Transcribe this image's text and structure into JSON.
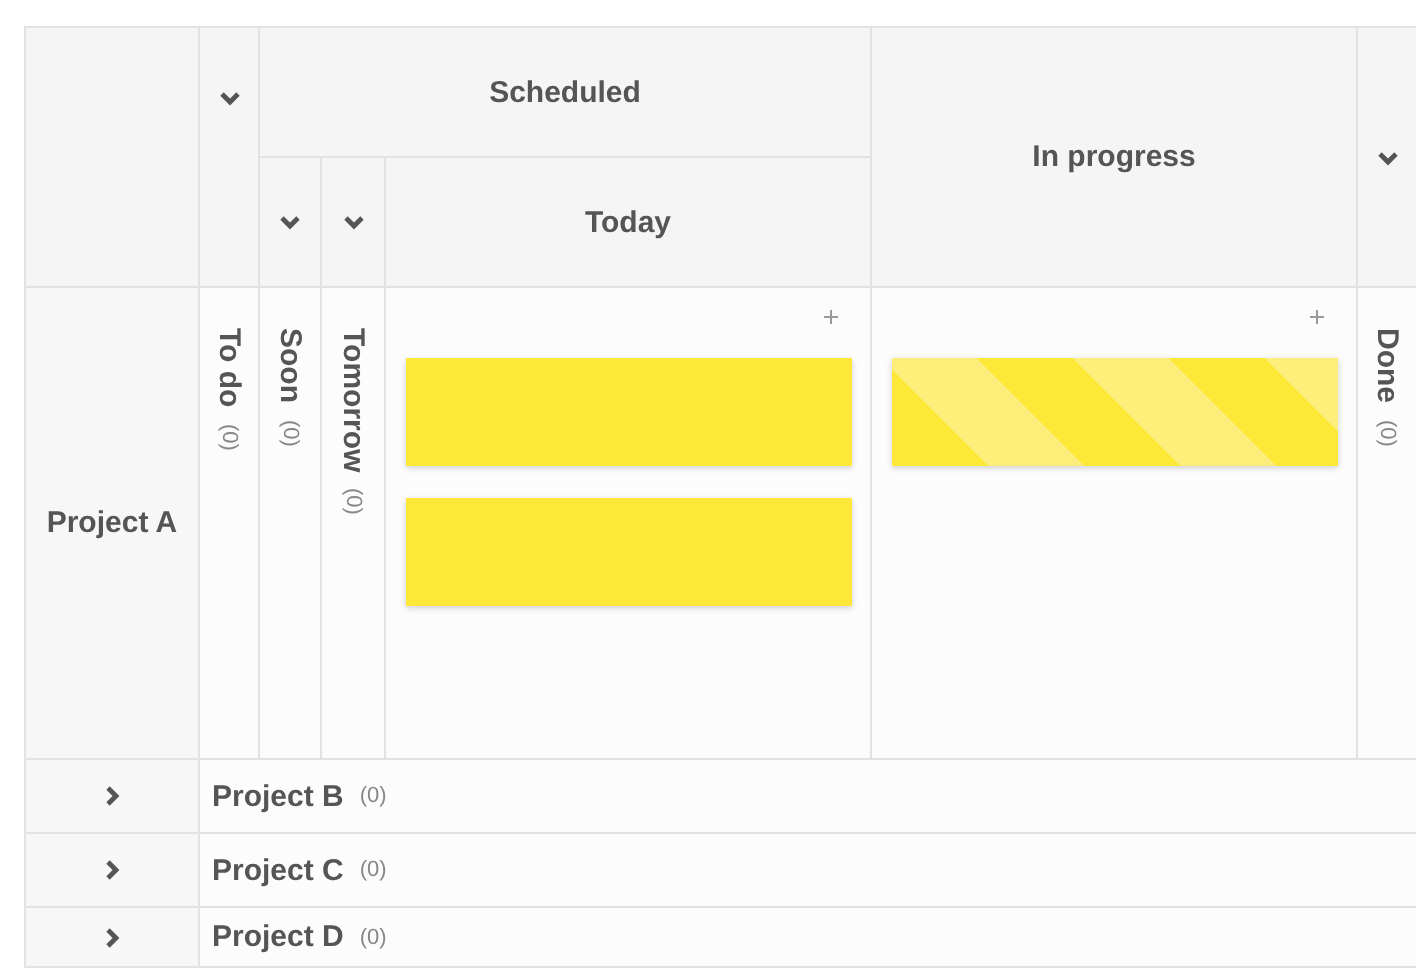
{
  "columns": [
    {
      "title": "To do",
      "count": "(0)",
      "expanded": false
    },
    {
      "title": "Scheduled",
      "children": [
        {
          "title": "Soon",
          "count": "(0)",
          "expanded": false
        },
        {
          "title": "Tomorrow",
          "count": "(0)",
          "expanded": false
        },
        {
          "title": "Today",
          "expanded": true
        }
      ]
    },
    {
      "title": "In progress",
      "expanded": true
    },
    {
      "title": "Done",
      "count": "(0)",
      "expanded": false
    }
  ],
  "lanes": [
    {
      "name": "Project A",
      "expanded": true,
      "cards": [
        [
          {
            "kind": "plain"
          },
          {
            "kind": "plain"
          }
        ],
        [
          {
            "kind": "striped"
          }
        ]
      ]
    },
    {
      "name": "Project B",
      "count": "(0)",
      "expanded": false
    },
    {
      "name": "Project C",
      "count": "(0)",
      "expanded": false
    },
    {
      "name": "Project D",
      "count": "(0)",
      "expanded": false
    }
  ]
}
